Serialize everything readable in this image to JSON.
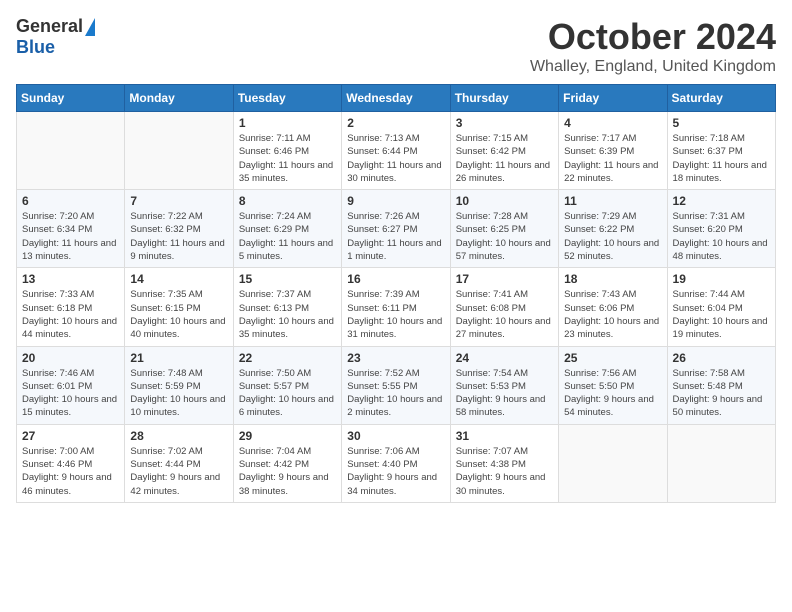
{
  "logo": {
    "general": "General",
    "blue": "Blue"
  },
  "header": {
    "month_title": "October 2024",
    "subtitle": "Whalley, England, United Kingdom"
  },
  "days_of_week": [
    "Sunday",
    "Monday",
    "Tuesday",
    "Wednesday",
    "Thursday",
    "Friday",
    "Saturday"
  ],
  "weeks": [
    [
      {
        "day": "",
        "info": ""
      },
      {
        "day": "",
        "info": ""
      },
      {
        "day": "1",
        "info": "Sunrise: 7:11 AM\nSunset: 6:46 PM\nDaylight: 11 hours and 35 minutes."
      },
      {
        "day": "2",
        "info": "Sunrise: 7:13 AM\nSunset: 6:44 PM\nDaylight: 11 hours and 30 minutes."
      },
      {
        "day": "3",
        "info": "Sunrise: 7:15 AM\nSunset: 6:42 PM\nDaylight: 11 hours and 26 minutes."
      },
      {
        "day": "4",
        "info": "Sunrise: 7:17 AM\nSunset: 6:39 PM\nDaylight: 11 hours and 22 minutes."
      },
      {
        "day": "5",
        "info": "Sunrise: 7:18 AM\nSunset: 6:37 PM\nDaylight: 11 hours and 18 minutes."
      }
    ],
    [
      {
        "day": "6",
        "info": "Sunrise: 7:20 AM\nSunset: 6:34 PM\nDaylight: 11 hours and 13 minutes."
      },
      {
        "day": "7",
        "info": "Sunrise: 7:22 AM\nSunset: 6:32 PM\nDaylight: 11 hours and 9 minutes."
      },
      {
        "day": "8",
        "info": "Sunrise: 7:24 AM\nSunset: 6:29 PM\nDaylight: 11 hours and 5 minutes."
      },
      {
        "day": "9",
        "info": "Sunrise: 7:26 AM\nSunset: 6:27 PM\nDaylight: 11 hours and 1 minute."
      },
      {
        "day": "10",
        "info": "Sunrise: 7:28 AM\nSunset: 6:25 PM\nDaylight: 10 hours and 57 minutes."
      },
      {
        "day": "11",
        "info": "Sunrise: 7:29 AM\nSunset: 6:22 PM\nDaylight: 10 hours and 52 minutes."
      },
      {
        "day": "12",
        "info": "Sunrise: 7:31 AM\nSunset: 6:20 PM\nDaylight: 10 hours and 48 minutes."
      }
    ],
    [
      {
        "day": "13",
        "info": "Sunrise: 7:33 AM\nSunset: 6:18 PM\nDaylight: 10 hours and 44 minutes."
      },
      {
        "day": "14",
        "info": "Sunrise: 7:35 AM\nSunset: 6:15 PM\nDaylight: 10 hours and 40 minutes."
      },
      {
        "day": "15",
        "info": "Sunrise: 7:37 AM\nSunset: 6:13 PM\nDaylight: 10 hours and 35 minutes."
      },
      {
        "day": "16",
        "info": "Sunrise: 7:39 AM\nSunset: 6:11 PM\nDaylight: 10 hours and 31 minutes."
      },
      {
        "day": "17",
        "info": "Sunrise: 7:41 AM\nSunset: 6:08 PM\nDaylight: 10 hours and 27 minutes."
      },
      {
        "day": "18",
        "info": "Sunrise: 7:43 AM\nSunset: 6:06 PM\nDaylight: 10 hours and 23 minutes."
      },
      {
        "day": "19",
        "info": "Sunrise: 7:44 AM\nSunset: 6:04 PM\nDaylight: 10 hours and 19 minutes."
      }
    ],
    [
      {
        "day": "20",
        "info": "Sunrise: 7:46 AM\nSunset: 6:01 PM\nDaylight: 10 hours and 15 minutes."
      },
      {
        "day": "21",
        "info": "Sunrise: 7:48 AM\nSunset: 5:59 PM\nDaylight: 10 hours and 10 minutes."
      },
      {
        "day": "22",
        "info": "Sunrise: 7:50 AM\nSunset: 5:57 PM\nDaylight: 10 hours and 6 minutes."
      },
      {
        "day": "23",
        "info": "Sunrise: 7:52 AM\nSunset: 5:55 PM\nDaylight: 10 hours and 2 minutes."
      },
      {
        "day": "24",
        "info": "Sunrise: 7:54 AM\nSunset: 5:53 PM\nDaylight: 9 hours and 58 minutes."
      },
      {
        "day": "25",
        "info": "Sunrise: 7:56 AM\nSunset: 5:50 PM\nDaylight: 9 hours and 54 minutes."
      },
      {
        "day": "26",
        "info": "Sunrise: 7:58 AM\nSunset: 5:48 PM\nDaylight: 9 hours and 50 minutes."
      }
    ],
    [
      {
        "day": "27",
        "info": "Sunrise: 7:00 AM\nSunset: 4:46 PM\nDaylight: 9 hours and 46 minutes."
      },
      {
        "day": "28",
        "info": "Sunrise: 7:02 AM\nSunset: 4:44 PM\nDaylight: 9 hours and 42 minutes."
      },
      {
        "day": "29",
        "info": "Sunrise: 7:04 AM\nSunset: 4:42 PM\nDaylight: 9 hours and 38 minutes."
      },
      {
        "day": "30",
        "info": "Sunrise: 7:06 AM\nSunset: 4:40 PM\nDaylight: 9 hours and 34 minutes."
      },
      {
        "day": "31",
        "info": "Sunrise: 7:07 AM\nSunset: 4:38 PM\nDaylight: 9 hours and 30 minutes."
      },
      {
        "day": "",
        "info": ""
      },
      {
        "day": "",
        "info": ""
      }
    ]
  ]
}
